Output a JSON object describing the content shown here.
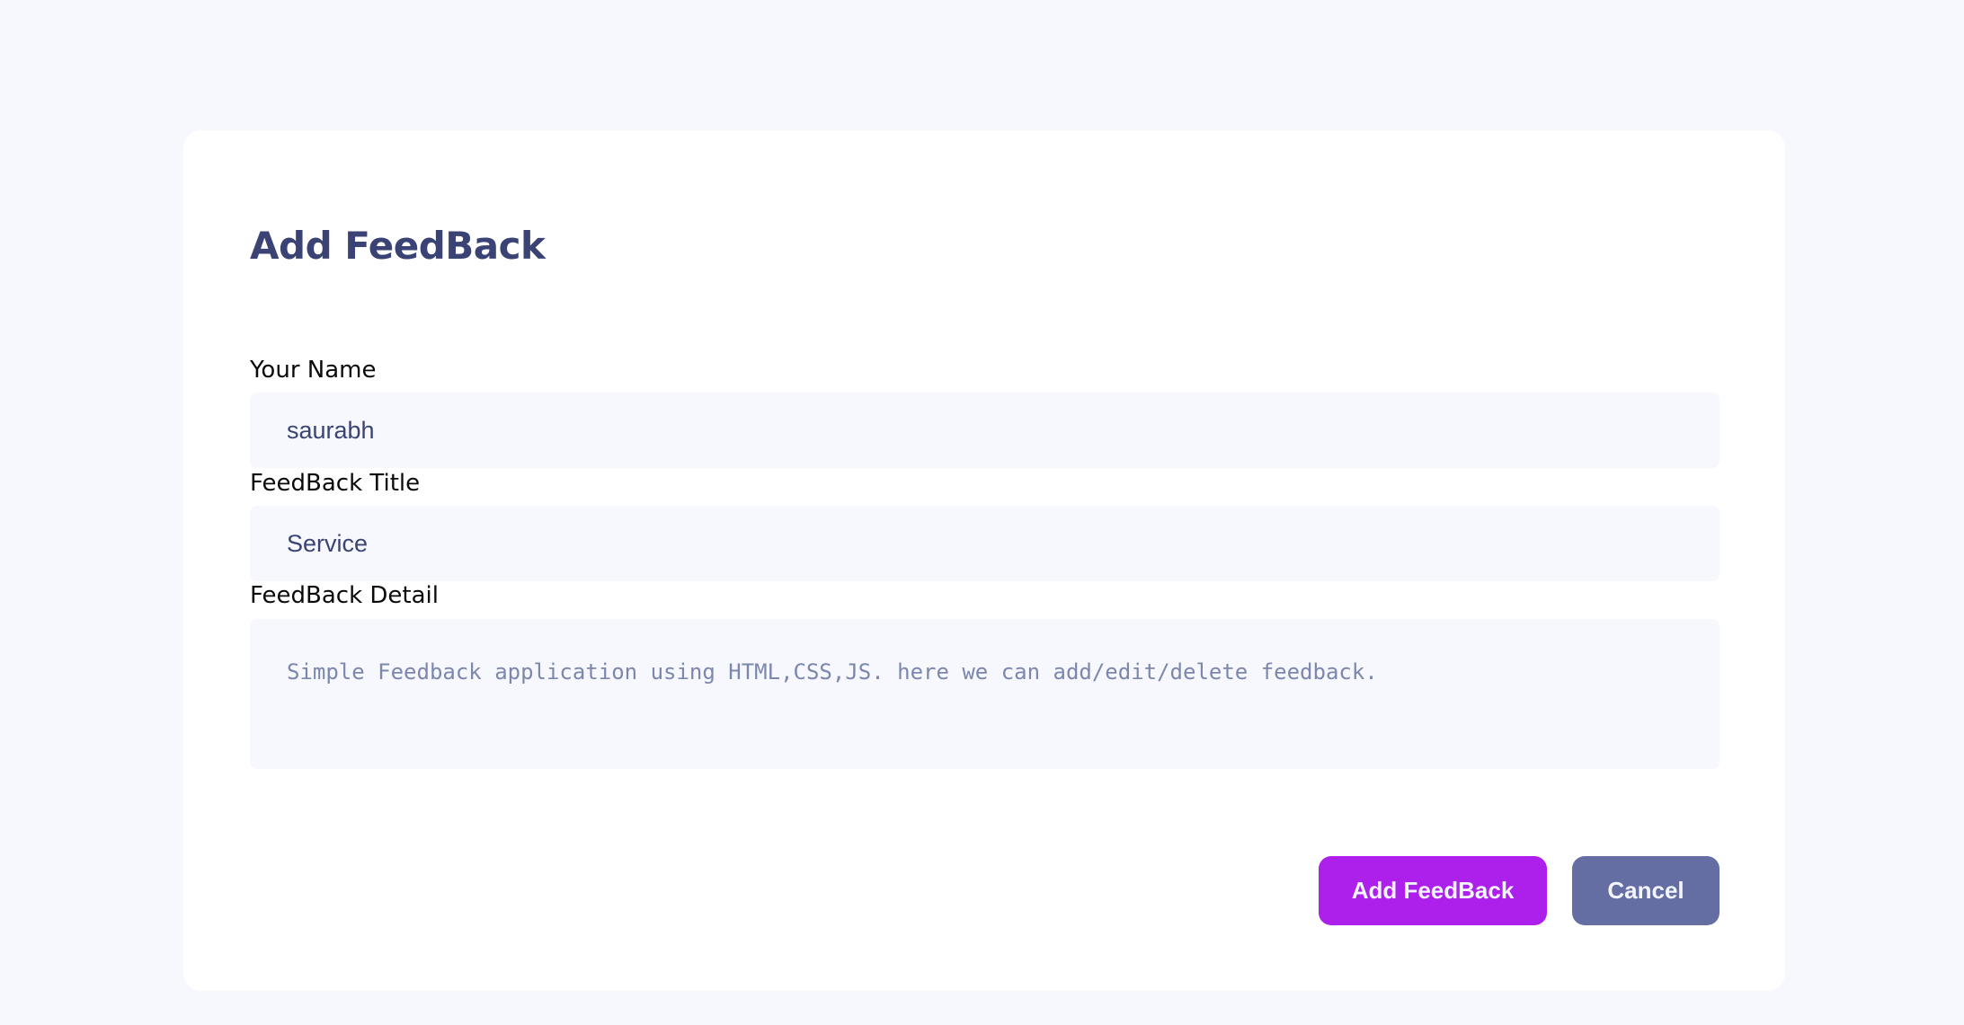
{
  "form": {
    "title": "Add FeedBack",
    "fields": [
      {
        "label": "Your Name",
        "value": "saurabh"
      },
      {
        "label": "FeedBack Title",
        "value": "Service"
      },
      {
        "label": "FeedBack Detail",
        "value": "Simple Feedback application using HTML,CSS,JS. here we can add/edit/delete feedback."
      }
    ],
    "actions": {
      "submit_label": "Add FeedBack",
      "cancel_label": "Cancel"
    }
  },
  "colors": {
    "page_background": "#f7f8fd",
    "card_background": "#ffffff",
    "title_text": "#3a4374",
    "input_background": "#f7f8fd",
    "submit_button": "#ad1fea",
    "cancel_button": "#656ea3",
    "button_text": "#f2f4fe"
  }
}
